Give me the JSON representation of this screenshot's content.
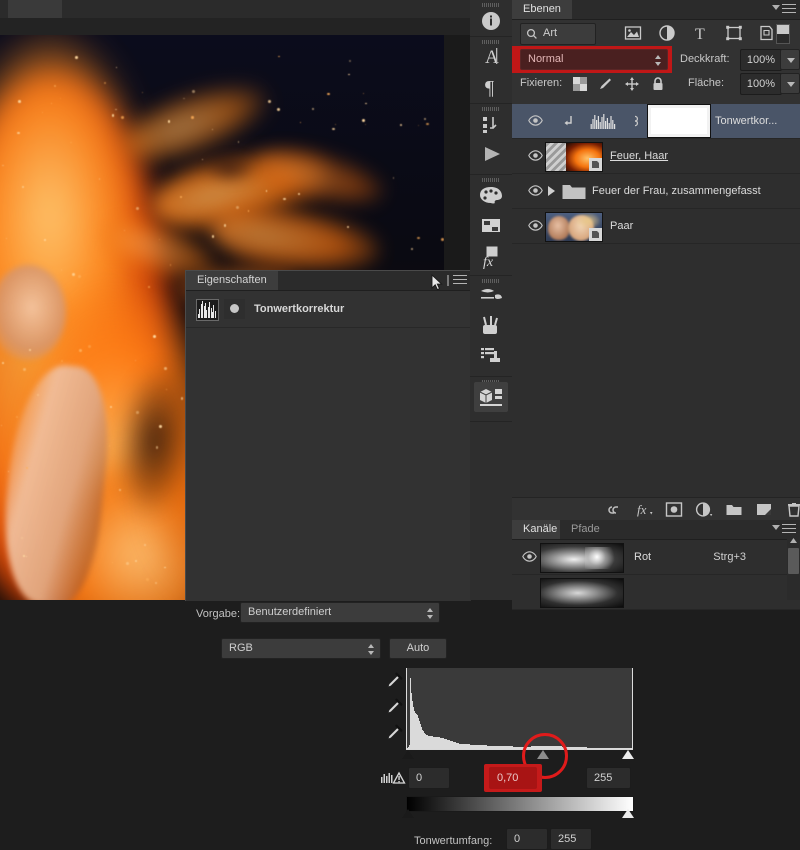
{
  "document": {
    "tab_title": "",
    "canvas_description": "fire-flames-photo"
  },
  "properties_panel": {
    "tab_label": "Eigenschaften",
    "adjustment_title": "Tonwertkorrektur",
    "preset_label": "Vorgabe:",
    "preset_value": "Benutzerdefiniert",
    "channel_value": "RGB",
    "auto_label": "Auto",
    "input_black": "0",
    "input_gamma": "0,70",
    "input_white": "255",
    "output_label": "Tonwertumfang:",
    "output_black": "0",
    "output_white": "255",
    "highlight_color": "#c51a1a"
  },
  "layers_panel": {
    "tab_label": "Ebenen",
    "filter_kind": "Art",
    "blend_mode": "Normal",
    "opacity_label": "Deckkraft:",
    "opacity_value": "100%",
    "lock_label": "Fixieren:",
    "fill_label": "Fläche:",
    "fill_value": "100%",
    "highlight_color": "#c01717",
    "layers": [
      {
        "name": "Tonwertkor...",
        "type": "adjustment",
        "selected": true,
        "visible": true,
        "underline": false
      },
      {
        "name": "Feuer, Haar ",
        "type": "image",
        "selected": false,
        "visible": true,
        "underline": true
      },
      {
        "name": "Feuer der Frau, zusammengefasst",
        "type": "group",
        "selected": false,
        "visible": true,
        "underline": false
      },
      {
        "name": "Paar",
        "type": "image",
        "selected": false,
        "visible": true,
        "underline": false
      }
    ]
  },
  "channels_panel": {
    "tab_active": "Kanäle",
    "tab_inactive": "Pfade",
    "channels": [
      {
        "name": "Rot",
        "shortcut": "Strg+3",
        "visible": true
      }
    ]
  },
  "dock": {
    "icons": [
      "info-icon",
      "character-icon",
      "paragraph-icon",
      "actions-icon",
      "play-icon",
      "color-icon",
      "swatches-icon",
      "fx-styles-icon",
      "brush-presets-icon",
      "brush-icon",
      "clone-source-icon",
      "properties-3d-icon"
    ]
  }
}
